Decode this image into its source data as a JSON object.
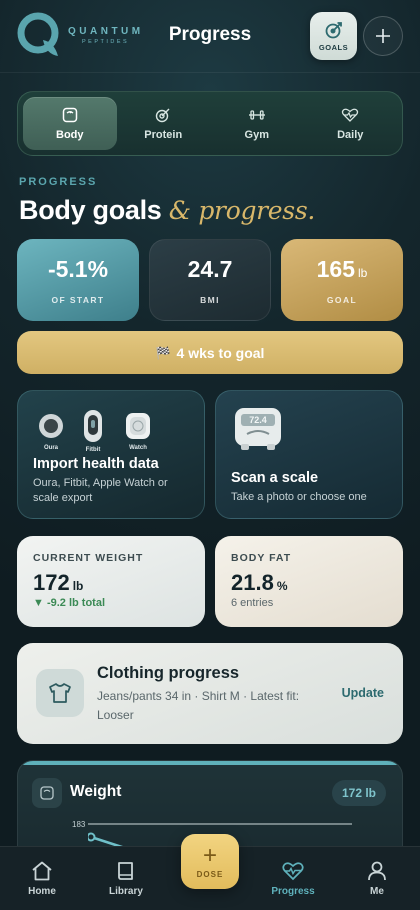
{
  "header": {
    "brand_line1": "QUANTUM",
    "brand_line2": "PEPTIDES",
    "title": "Progress",
    "goals_label": "GOALS",
    "add_icon": "plus-icon"
  },
  "tabs": [
    {
      "label": "Body",
      "icon": "scale-icon",
      "active": true
    },
    {
      "label": "Protein",
      "icon": "target-icon",
      "active": false
    },
    {
      "label": "Gym",
      "icon": "dumbbell-icon",
      "active": false
    },
    {
      "label": "Daily",
      "icon": "heartbeat-icon",
      "active": false
    }
  ],
  "section": {
    "eyebrow": "PROGRESS",
    "headline_main": "Body goals",
    "headline_accent": "& progress."
  },
  "stats": [
    {
      "value": "-5.1%",
      "unit": "",
      "label": "OF START"
    },
    {
      "value": "24.7",
      "unit": "",
      "label": "BMI"
    },
    {
      "value": "165",
      "unit": "lb",
      "label": "GOAL"
    }
  ],
  "countdown": {
    "flag": "🏁",
    "text": "4 wks to goal"
  },
  "import_card": {
    "devices": [
      {
        "label": "Oura"
      },
      {
        "label": "Fitbit"
      },
      {
        "label": "Watch"
      }
    ],
    "title": "Import health data",
    "subtitle": "Oura, Fitbit, Apple Watch or scale export"
  },
  "scan_card": {
    "scale_reading": "72.4",
    "title": "Scan a scale",
    "subtitle": "Take a photo or choose one"
  },
  "current_weight": {
    "label": "CURRENT WEIGHT",
    "value": "172",
    "unit": "lb",
    "delta": "▼ -9.2 lb total"
  },
  "body_fat": {
    "label": "BODY FAT",
    "value": "21.8",
    "unit": "%",
    "entries": "6 entries"
  },
  "clothing": {
    "title": "Clothing progress",
    "subtitle": "Jeans/pants 34 in · Shirt M · Latest fit: Looser",
    "action": "Update"
  },
  "weight_card": {
    "title": "Weight",
    "pill": "172 lb",
    "axis_top": "183"
  },
  "nav": [
    {
      "label": "Home",
      "icon": "home-icon",
      "active": false
    },
    {
      "label": "Library",
      "icon": "book-icon",
      "active": false
    },
    {
      "label": "Progress",
      "icon": "heartbeat-icon",
      "active": true
    },
    {
      "label": "Me",
      "icon": "user-icon",
      "active": false
    }
  ],
  "dose": {
    "plus": "+",
    "label": "DOSE"
  },
  "colors": {
    "accent_teal": "#5fb2bc",
    "accent_gold": "#d8b76a",
    "background": "#14262c"
  }
}
